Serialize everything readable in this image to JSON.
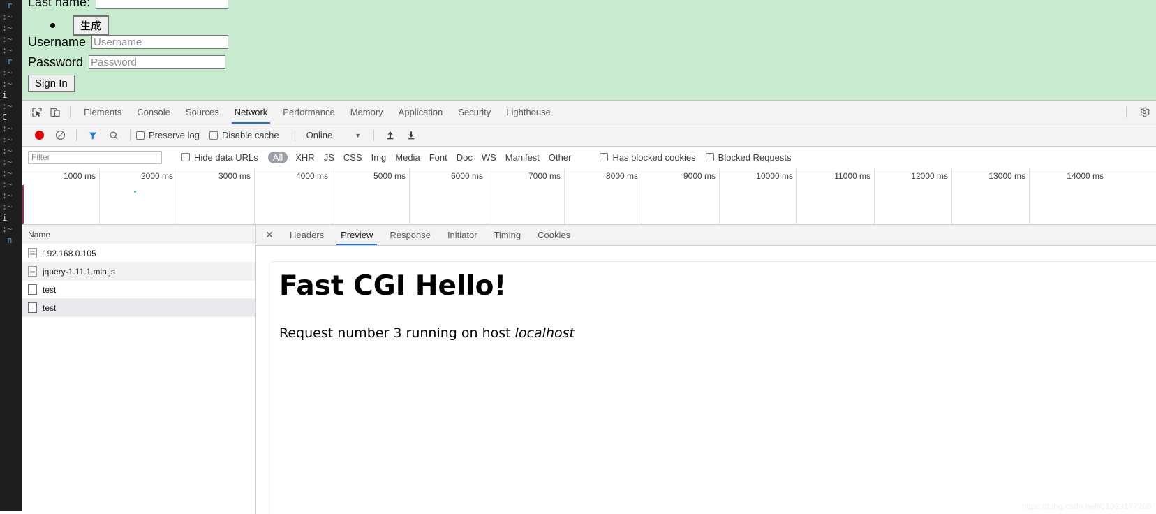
{
  "editor": {
    "lines": [
      {
        "g": "",
        "t": "r"
      },
      {
        "g": ":",
        "t": "~"
      },
      {
        "g": ":",
        "t": "~"
      },
      {
        "g": "",
        "t": "r"
      },
      {
        "g": ":",
        "t": "~"
      },
      {
        "g": ":",
        "t": "~"
      },
      {
        "g": "i",
        "t": ""
      },
      {
        "g": ":",
        "t": "~"
      },
      {
        "g": "C",
        "t": ""
      },
      {
        "g": ":",
        "t": "~"
      },
      {
        "g": ":",
        "t": "~"
      },
      {
        "g": ":",
        "t": "~"
      },
      {
        "g": ":",
        "t": "~"
      },
      {
        "g": ":",
        "t": "~"
      },
      {
        "g": ":",
        "t": "~"
      },
      {
        "g": ":",
        "t": "~"
      },
      {
        "g": "i",
        "t": ""
      },
      {
        "g": ":",
        "t": "~"
      },
      {
        "g": "",
        "t": "n"
      }
    ]
  },
  "page_form": {
    "last_name_label": "Last name:",
    "last_name_value": "",
    "generate_button": "生成",
    "username_label": "Username",
    "username_placeholder": "Username",
    "username_value": "",
    "password_label": "Password",
    "password_placeholder": "Password",
    "password_value": "",
    "signin_button": "Sign In",
    "background_color": "#c8ebd0"
  },
  "devtools": {
    "tabs": [
      {
        "label": "Elements",
        "active": false
      },
      {
        "label": "Console",
        "active": false
      },
      {
        "label": "Sources",
        "active": false
      },
      {
        "label": "Network",
        "active": true
      },
      {
        "label": "Performance",
        "active": false
      },
      {
        "label": "Memory",
        "active": false
      },
      {
        "label": "Application",
        "active": false
      },
      {
        "label": "Security",
        "active": false
      },
      {
        "label": "Lighthouse",
        "active": false
      }
    ],
    "icons": {
      "inspect": "inspect-element-icon",
      "device": "device-toolbar-icon",
      "settings": "gear-icon"
    },
    "toolbar": {
      "record_title": "record-button",
      "clear_title": "clear-button",
      "filter_title": "filter-icon",
      "search_title": "search-icon",
      "preserve_log_label": "Preserve log",
      "preserve_log_checked": false,
      "disable_cache_label": "Disable cache",
      "disable_cache_checked": false,
      "throttling_value": "Online",
      "import_title": "import-har-icon",
      "export_title": "export-har-icon"
    },
    "filterbar": {
      "filter_placeholder": "Filter",
      "filter_value": "",
      "hide_data_urls_label": "Hide data URLs",
      "hide_data_urls_checked": false,
      "types": [
        "All",
        "XHR",
        "JS",
        "CSS",
        "Img",
        "Media",
        "Font",
        "Doc",
        "WS",
        "Manifest",
        "Other"
      ],
      "selected_type": "All",
      "has_blocked_cookies_label": "Has blocked cookies",
      "has_blocked_cookies_checked": false,
      "blocked_requests_label": "Blocked Requests",
      "blocked_requests_checked": false
    },
    "overview": {
      "ticks": [
        "1000 ms",
        "2000 ms",
        "3000 ms",
        "4000 ms",
        "5000 ms",
        "6000 ms",
        "7000 ms",
        "8000 ms",
        "9000 ms",
        "10000 ms",
        "11000 ms",
        "12000 ms",
        "13000 ms",
        "14000 ms"
      ],
      "marker_color": "#a03050"
    },
    "requests": {
      "column_name": "Name",
      "rows": [
        {
          "name": "192.168.0.105",
          "icon": "document-icon",
          "selected": false
        },
        {
          "name": "jquery-1.11.1.min.js",
          "icon": "document-icon",
          "selected": false
        },
        {
          "name": "test",
          "icon": "blank-document-icon",
          "selected": false
        },
        {
          "name": "test",
          "icon": "blank-document-icon",
          "selected": true
        }
      ]
    },
    "detail": {
      "close_icon": "close-icon",
      "tabs": [
        {
          "label": "Headers",
          "active": false
        },
        {
          "label": "Preview",
          "active": true
        },
        {
          "label": "Response",
          "active": false
        },
        {
          "label": "Initiator",
          "active": false
        },
        {
          "label": "Timing",
          "active": false
        },
        {
          "label": "Cookies",
          "active": false
        }
      ],
      "preview": {
        "heading": "Fast CGI Hello!",
        "body_prefix": "Request number 3 running on host ",
        "body_host": "localhost"
      }
    },
    "accent_color": "#1a73e8",
    "watermark": "https://blog.csdn.net/C1033177205"
  }
}
